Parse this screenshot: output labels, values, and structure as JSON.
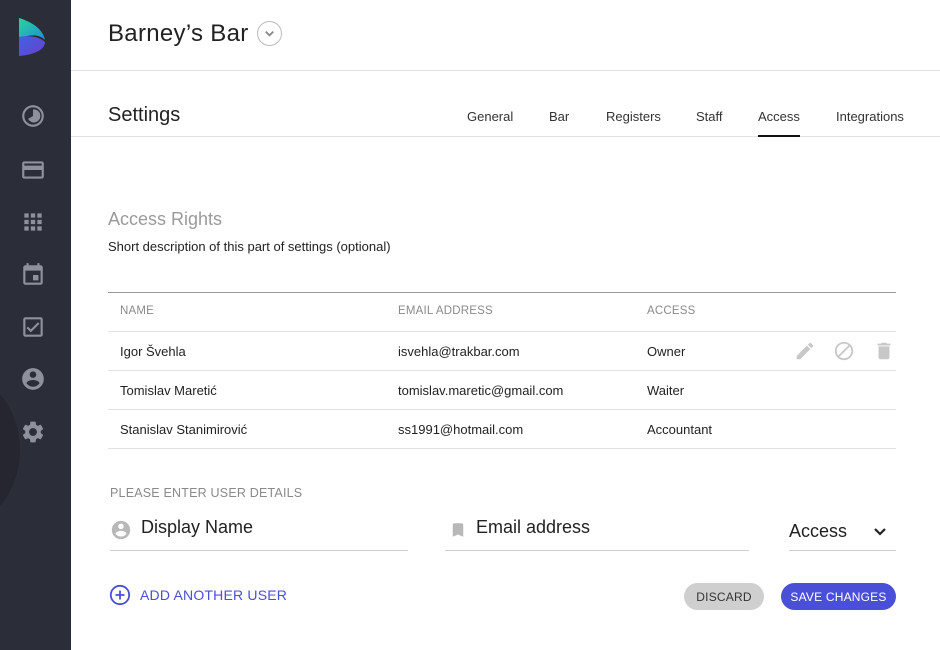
{
  "header": {
    "title": "Barney’s Bar"
  },
  "settings": {
    "title": "Settings",
    "tabs": [
      {
        "label": "General"
      },
      {
        "label": "Bar"
      },
      {
        "label": "Registers"
      },
      {
        "label": "Staff"
      },
      {
        "label": "Access",
        "active": true
      },
      {
        "label": "Integrations"
      }
    ]
  },
  "sidebar": {
    "items": [
      {
        "icon": "dashboard-icon"
      },
      {
        "icon": "credit-card-icon"
      },
      {
        "icon": "apps-grid-icon"
      },
      {
        "icon": "calendar-icon"
      },
      {
        "icon": "checkbox-icon"
      },
      {
        "icon": "account-icon"
      },
      {
        "icon": "settings-gear-icon"
      }
    ]
  },
  "access": {
    "title": "Access Rights",
    "description": "Short description of this part of settings (optional)",
    "columns": {
      "name": "NAME",
      "email": "EMAIL ADDRESS",
      "access": "ACCESS"
    },
    "users": [
      {
        "name": "Igor Švehla",
        "email": "isvehla@trakbar.com",
        "access": "Owner"
      },
      {
        "name": "Tomislav Maretić",
        "email": "tomislav.maretic@gmail.com",
        "access": "Waiter"
      },
      {
        "name": "Stanislav Stanimirović",
        "email": "ss1991@hotmail.com",
        "access": "Accountant"
      }
    ]
  },
  "form": {
    "label": "PLEASE ENTER USER DETAILS",
    "name_placeholder": "Display Name",
    "email_placeholder": "Email address",
    "access_value": "Access",
    "add_user_label": "ADD ANOTHER USER",
    "discard_label": "DISCARD",
    "save_label": "SAVE CHANGES"
  },
  "colors": {
    "accent": "#4a4fd8",
    "sidebar": "#2b2d38"
  }
}
